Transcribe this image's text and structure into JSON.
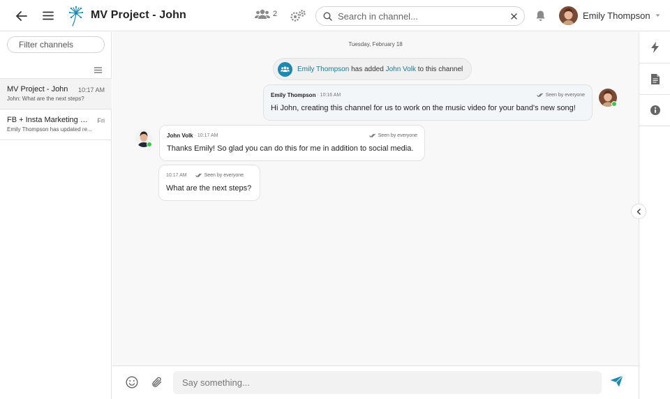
{
  "header": {
    "title": "MV Project - John",
    "members_count": "2",
    "search_placeholder": "Search in channel...",
    "user_name": "Emily Thompson"
  },
  "sidebar": {
    "filter_placeholder": "Filter channels",
    "channels": [
      {
        "name": "MV Project - John",
        "time": "10:17 AM",
        "preview": "John: What are the next steps?"
      },
      {
        "name": "FB + Insta Marketing - ...",
        "time": "Fri",
        "preview": "Emily Thompson has updated re..."
      }
    ]
  },
  "main": {
    "date_separator": "Tuesday, February 18",
    "system_message": {
      "actor": "Emily Thompson",
      "action": "has added",
      "target": "John Volk",
      "suffix": "to this channel"
    },
    "messages": [
      {
        "author": "Emily Thompson",
        "time": "· 10:16 AM",
        "seen": "Seen by everyone",
        "text": "Hi John, creating this channel for us to work on the music video for your band's new song!"
      },
      {
        "author": "John Volk",
        "time": "· 10:17 AM",
        "seen": "Seen by everyone",
        "text": "Thanks Emily! So glad you can do this for me in addition to social media."
      },
      {
        "author": "",
        "time": "10:17 AM",
        "seen": "Seen by everyone",
        "text": "What are the next steps?"
      }
    ]
  },
  "composer": {
    "placeholder": "Say something..."
  },
  "icons": {
    "back": "back-arrow-icon",
    "menu": "hamburger-menu-icon",
    "logo": "dandelion-logo-icon",
    "members": "users-group-icon",
    "settings": "gears-icon",
    "search": "search-icon",
    "clear": "close-icon",
    "notifications": "bell-icon",
    "dropdown": "chevron-down-icon",
    "rail": [
      "lightning-icon",
      "file-icon",
      "info-icon"
    ],
    "collapse": "chevron-left-icon",
    "emoji": "smiley-icon",
    "attach": "paperclip-icon",
    "send": "send-icon"
  },
  "colors": {
    "accent": "#1c8ab0",
    "link": "#177a99",
    "online": "#34c84a"
  }
}
